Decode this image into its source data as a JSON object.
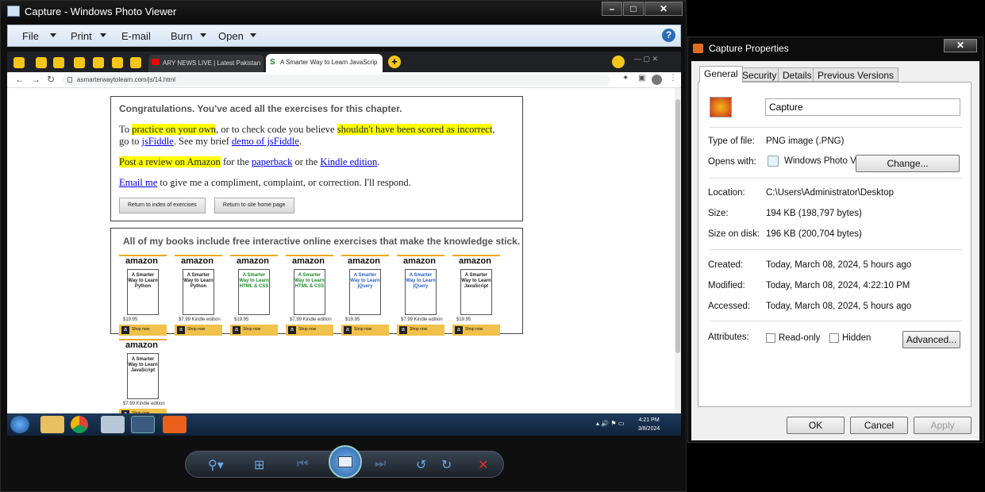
{
  "viewer": {
    "title": "Capture - Windows Photo Viewer",
    "menu": [
      "File",
      "Print",
      "E-mail",
      "Burn",
      "Open"
    ]
  },
  "browser": {
    "tab_ary": "ARY NEWS LIVE | Latest Pakistan",
    "tab_active": "A Smarter Way to Learn JavaScrip",
    "url": "asmarterwaytolearn.com/js/14.html"
  },
  "page": {
    "heading": "Congratulations. You've aced all the exercises for this chapter.",
    "p1_a": "To ",
    "p1_hl1": "practice on your own",
    "p1_b": ", or to check code you believe ",
    "p1_hl2": "shouldn't have been scored as incorrect",
    "p1_c": ",",
    "p1_d": "go to ",
    "p1_link1": "jsFiddle",
    "p1_e": ". See my brief ",
    "p1_link2": "demo of jsFiddle",
    "p1_f": ".",
    "p2_hl": "Post a review on Amazon",
    "p2_a": " for the ",
    "p2_link1": "paperback",
    "p2_b": " or the ",
    "p2_link2": "Kindle edition",
    "p2_c": ".",
    "p3_link": "Email me",
    "p3_a": " to give me a compliment, complaint, or correction. I'll respond.",
    "btn_index": "Return to index of exercises",
    "btn_home": "Return to site home page",
    "books_heading": "All of my books include free interactive online exercises that make the knowledge stick.",
    "books": [
      {
        "brand": "amazon",
        "title": "A Smarter Way to Learn Python",
        "price": "$19.95",
        "shop": "Shop now",
        "color": "#222"
      },
      {
        "brand": "amazon",
        "title": "A Smarter Way to Learn Python",
        "price": "$7.99 Kindle edition",
        "shop": "Shop now",
        "color": "#222"
      },
      {
        "brand": "amazon",
        "title": "A Smarter Way to Learn HTML & CSS",
        "price": "$19.95",
        "shop": "Shop now",
        "color": "#1a8a2a"
      },
      {
        "brand": "amazon",
        "title": "A Smarter Way to Learn HTML & CSS",
        "price": "$7.99 Kindle edition",
        "shop": "Shop now",
        "color": "#1a8a2a"
      },
      {
        "brand": "amazon",
        "title": "A Smarter Way to Learn jQuery",
        "price": "$19.95",
        "shop": "Shop now",
        "color": "#2a5fc8"
      },
      {
        "brand": "amazon",
        "title": "A Smarter Way to Learn jQuery",
        "price": "$7.99 Kindle edition",
        "shop": "Shop now",
        "color": "#2a5fc8"
      },
      {
        "brand": "amazon",
        "title": "A Smarter Way to Learn JavaScript",
        "price": "$19.95",
        "shop": "Shop now",
        "color": "#222"
      },
      {
        "brand": "amazon",
        "title": "A Smarter Way to Learn JavaScript",
        "price": "$7.99 Kindle edition",
        "shop": "Shop now",
        "color": "#222"
      }
    ]
  },
  "taskbar": {
    "time": "4:21 PM",
    "date": "3/8/2024"
  },
  "props": {
    "title": "Capture Properties",
    "tabs": [
      "General",
      "Security",
      "Details",
      "Previous Versions"
    ],
    "filename": "Capture",
    "type_label": "Type of file:",
    "type_value": "PNG image (.PNG)",
    "opens_label": "Opens with:",
    "opens_value": "Windows Photo Viewer",
    "change": "Change...",
    "location_label": "Location:",
    "location_value": "C:\\Users\\Administrator\\Desktop",
    "size_label": "Size:",
    "size_value": "194 KB (198,797 bytes)",
    "sod_label": "Size on disk:",
    "sod_value": "196 KB (200,704 bytes)",
    "created_label": "Created:",
    "created_value": "Today, March 08, 2024, 5 hours ago",
    "modified_label": "Modified:",
    "modified_value": "Today, March 08, 2024, 4:22:10 PM",
    "accessed_label": "Accessed:",
    "accessed_value": "Today, March 08, 2024, 5 hours ago",
    "attr_label": "Attributes:",
    "readonly": "Read-only",
    "hidden": "Hidden",
    "advanced": "Advanced...",
    "ok": "OK",
    "cancel": "Cancel",
    "apply": "Apply"
  }
}
